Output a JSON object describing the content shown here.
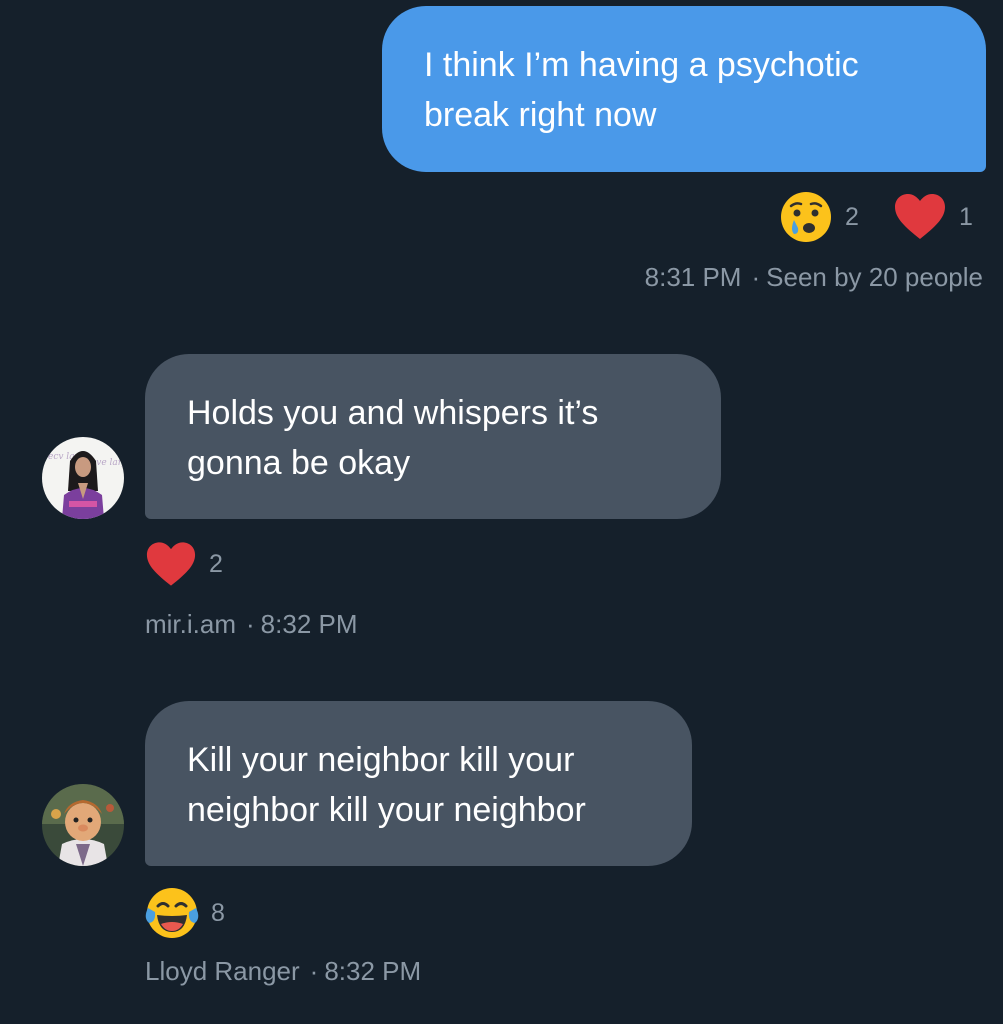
{
  "messages": [
    {
      "direction": "outgoing",
      "text_line1": "I think I’m having a psychotic",
      "text_line2": "break right now",
      "reactions": [
        {
          "icon": "sad-tear-emoji",
          "count": "2"
        },
        {
          "icon": "heart-icon",
          "count": "1"
        }
      ],
      "time": "8:31 PM",
      "seen": "Seen by 20 people"
    },
    {
      "direction": "incoming",
      "text_line1": "Holds you and whispers it’s",
      "text_line2": "gonna be okay",
      "reactions": [
        {
          "icon": "heart-icon",
          "count": "2"
        }
      ],
      "sender": "mir.i.am",
      "time": "8:32 PM"
    },
    {
      "direction": "incoming",
      "text_line1": "Kill your neighbor kill your",
      "text_line2": "neighbor kill your neighbor",
      "reactions": [
        {
          "icon": "laughing-tears-emoji",
          "count": "8"
        }
      ],
      "sender": "Lloyd Ranger",
      "time": "8:32 PM"
    }
  ],
  "separator": "·",
  "colors": {
    "background": "#15202b",
    "outgoing_bubble": "#4a99e9",
    "incoming_bubble": "#485462",
    "muted_text": "#8b98a5",
    "heart": "#e0393e"
  }
}
